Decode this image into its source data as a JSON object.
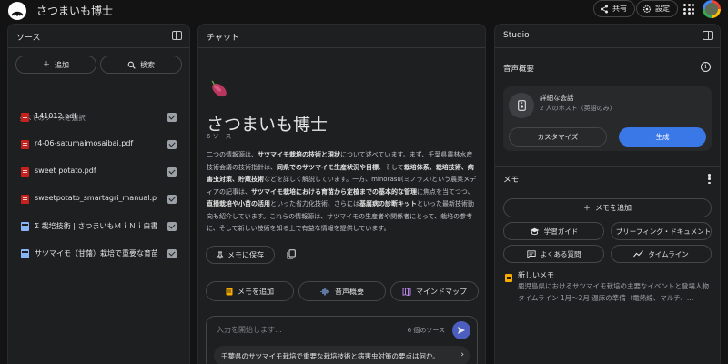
{
  "header": {
    "app_title": "さつまいも博士",
    "share_label": "共有",
    "settings_label": "設定"
  },
  "sources_panel": {
    "title": "ソース",
    "add_label": "追加",
    "search_label": "検索",
    "select_all_label": "すべてのソースを選択",
    "items": [
      {
        "label": "141012.pdf",
        "type": "pdf",
        "checked": true
      },
      {
        "label": "r4-06-satumaimosaibai.pdf",
        "type": "pdf",
        "checked": true
      },
      {
        "label": "sweet potato.pdf",
        "type": "pdf",
        "checked": true
      },
      {
        "label": "sweetpotato_smartagri_manual.pdf",
        "type": "pdf",
        "checked": true
      },
      {
        "label": "Σ 栽培技術 | さつまいもＭｉＮｉ白書 |...",
        "type": "doc",
        "checked": true
      },
      {
        "label": "サツマイモ（甘藷）栽培で重要な育苗...",
        "type": "doc",
        "checked": true
      }
    ]
  },
  "chat_panel": {
    "title": "チャット",
    "notebook_title": "さつまいも博士",
    "source_count": "6 ソース",
    "summary_segments": [
      {
        "t": "二つの情報源は、",
        "b": false
      },
      {
        "t": "サツマイモ栽培の技術と現状",
        "b": true
      },
      {
        "t": "について述べています。まず、千葉県農林水産技術会議の技術指針は、",
        "b": false
      },
      {
        "t": "同県でのサツマイモ生産状況や目標",
        "b": true
      },
      {
        "t": "、そして",
        "b": false
      },
      {
        "t": "栽培体系、栽培技術、病害虫対策、貯蔵技術",
        "b": true
      },
      {
        "t": "などを詳しく解説しています。一方、minorasu(ミノラス)という農業メディアの記事は、",
        "b": false
      },
      {
        "t": "サツマイモ栽培における育苗から定植までの基本的な管理",
        "b": true
      },
      {
        "t": "に焦点を当てつつ、",
        "b": false
      },
      {
        "t": "直播栽培や小苗の活用",
        "b": true
      },
      {
        "t": "といった省力化技術、さらには",
        "b": false
      },
      {
        "t": "基腐病の診断キット",
        "b": true
      },
      {
        "t": "といった最新技術動向も紹介しています。これらの情報源は、サツマイモの生産者や関係者にとって、栽培の参考に、そして新しい技術を知る上で有益な情報を提供しています。",
        "b": false
      }
    ],
    "save_to_note_label": "メモに保存",
    "actions": {
      "add_note": "メモを追加",
      "audio_overview": "音声概要",
      "mind_map": "マインドマップ"
    },
    "input_placeholder": "入力を開始します...",
    "input_source_count": "6 個のソース",
    "suggestion": "千葉県のサツマイモ栽培で重要な栽培技術と病害虫対策の要点は何か。"
  },
  "studio_panel": {
    "title": "Studio",
    "audio_section_label": "音声概要",
    "audio_card": {
      "title": "詳細な会話",
      "subtitle": "2 人のホスト（英語のみ）",
      "customize_label": "カスタマイズ",
      "generate_label": "生成"
    },
    "notes_section_label": "メモ",
    "add_note_label": "メモを追加",
    "note_buttons": {
      "study_guide": "学習ガイド",
      "briefing": "ブリーフィング・ドキュメント",
      "faq": "よくある質問",
      "timeline": "タイムライン"
    },
    "note_item": {
      "title": "新しいメモ",
      "preview": "鹿児島県におけるサツマイモ栽培の主要なイベントと登場人物 タイムライン 1月～2月 温床の準備（電熱線、マルチ、..."
    }
  },
  "colors": {
    "background": "#131314",
    "panel": "#1e1f20",
    "accent_blue": "#3b78e7",
    "send_button": "#4c5ebf",
    "pdf_red": "#c5221f",
    "note_yellow": "#f9ab00"
  },
  "icons": [
    "notebook-logo-icon",
    "share-icon",
    "gear-icon",
    "apps-grid-icon",
    "panel-toggle-icon",
    "plus-icon",
    "search-icon",
    "pdf-icon",
    "doc-icon",
    "pin-icon",
    "copy-icon",
    "note-icon",
    "waveform-icon",
    "mindmap-icon",
    "send-icon",
    "info-icon",
    "kebab-icon",
    "graduation-cap-icon",
    "document-icon",
    "faq-icon",
    "timeline-icon",
    "sweet-potato-icon",
    "arrow-right-icon"
  ]
}
